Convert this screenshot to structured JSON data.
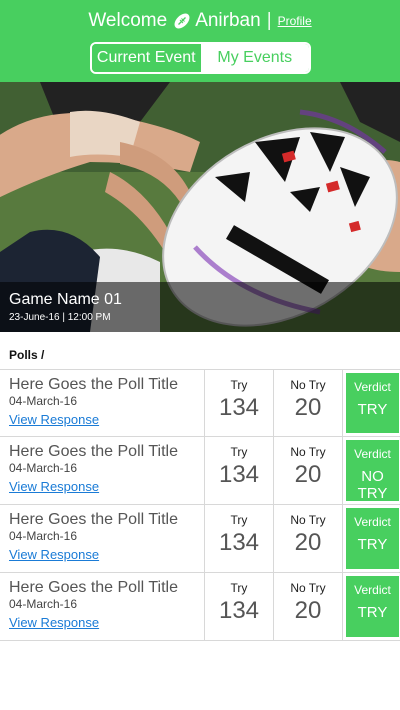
{
  "header": {
    "welcome_text": "Welcome",
    "user_name": "Anirban",
    "separator": "|",
    "profile_label": "Profile",
    "tabs": [
      {
        "label": "Current Event",
        "active": true
      },
      {
        "label": "My Events",
        "active": false
      }
    ],
    "accent_color": "#48cf5f"
  },
  "event": {
    "name": "Game Name 01",
    "date_time": "23-June-16 | 12:00 PM"
  },
  "polls_heading": "Polls /",
  "polls": [
    {
      "title": "Here Goes the Poll Title",
      "date": "04-March-16",
      "link": "View Response",
      "try_label": "Try",
      "try_count": "134",
      "notry_label": "No Try",
      "notry_count": "20",
      "verdict_label": "Verdict",
      "verdict_value": "TRY"
    },
    {
      "title": "Here Goes the Poll Title",
      "date": "04-March-16",
      "link": "View Response",
      "try_label": "Try",
      "try_count": "134",
      "notry_label": "No Try",
      "notry_count": "20",
      "verdict_label": "Verdict",
      "verdict_value": "NO TRY"
    },
    {
      "title": "Here Goes the Poll Title",
      "date": "04-March-16",
      "link": "View Response",
      "try_label": "Try",
      "try_count": "134",
      "notry_label": "No Try",
      "notry_count": "20",
      "verdict_label": "Verdict",
      "verdict_value": "TRY"
    },
    {
      "title": "Here Goes the Poll Title",
      "date": "04-March-16",
      "link": "View Response",
      "try_label": "Try",
      "try_count": "134",
      "notry_label": "No Try",
      "notry_count": "20",
      "verdict_label": "Verdict",
      "verdict_value": "TRY"
    }
  ]
}
